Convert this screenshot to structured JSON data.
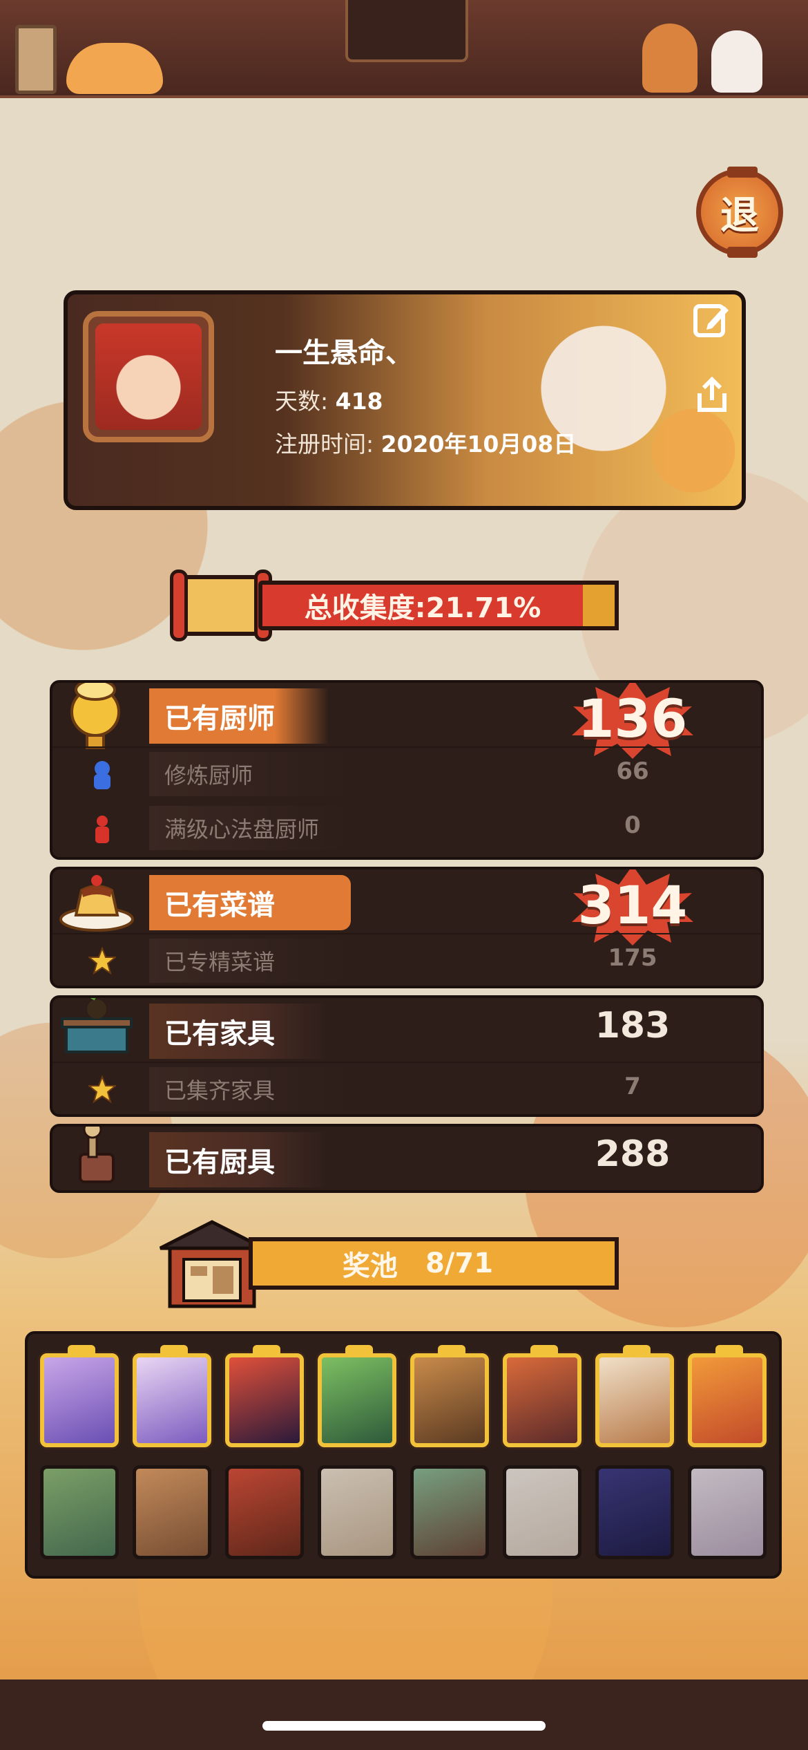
{
  "exit_button": {
    "label": "退"
  },
  "profile": {
    "name": "一生悬命、",
    "days_label": "天数:",
    "days_value": "418",
    "register_label": "注册时间:",
    "register_value": "2020年10月08日",
    "edit_icon": "edit-icon",
    "share_icon": "share-icon"
  },
  "collection": {
    "label": "总收集度:21.71%"
  },
  "chefs": {
    "label": "已有厨师",
    "value": "136",
    "subs": [
      {
        "label": "修炼厨师",
        "value": "66",
        "icon": "blue-figure-icon"
      },
      {
        "label": "满级心法盘厨师",
        "value": "0",
        "icon": "red-figure-icon"
      }
    ]
  },
  "recipes": {
    "label": "已有菜谱",
    "value": "314",
    "subs": [
      {
        "label": "已专精菜谱",
        "value": "175",
        "icon": "star-icon"
      }
    ]
  },
  "furniture": {
    "label": "已有家具",
    "value": "183",
    "subs": [
      {
        "label": "已集齐家具",
        "value": "7",
        "icon": "star-icon"
      }
    ]
  },
  "utensils": {
    "label": "已有厨具",
    "value": "288"
  },
  "prize_pool": {
    "label": "奖池",
    "count": "8/71"
  },
  "pool_cards": {
    "collected": [
      {
        "colors": [
          "#c9a6e8",
          "#6a4fb3"
        ]
      },
      {
        "colors": [
          "#e9d6f3",
          "#7c5bbf"
        ]
      },
      {
        "colors": [
          "#e0503a",
          "#2a1a3a"
        ]
      },
      {
        "colors": [
          "#7dbf62",
          "#2e5a3a"
        ]
      },
      {
        "colors": [
          "#c98a4a",
          "#5a3a22"
        ]
      },
      {
        "colors": [
          "#d96a3a",
          "#5a2a2a"
        ]
      },
      {
        "colors": [
          "#f0e0c8",
          "#b87a4a"
        ]
      },
      {
        "colors": [
          "#f29a3a",
          "#c24a2a"
        ]
      }
    ],
    "uncollected": [
      {
        "colors": [
          "#8fbf7a",
          "#4a7a5a"
        ]
      },
      {
        "colors": [
          "#e8a56a",
          "#8a5a3a"
        ]
      },
      {
        "colors": [
          "#e0503a",
          "#6a2a1a"
        ]
      },
      {
        "colors": [
          "#f2e8d8",
          "#c8b49a"
        ]
      },
      {
        "colors": [
          "#8abf9a",
          "#6a4a3a"
        ]
      },
      {
        "colors": [
          "#f4efe8",
          "#d8ccc0"
        ]
      },
      {
        "colors": [
          "#3a3a8a",
          "#1a1a4a"
        ]
      },
      {
        "colors": [
          "#e8e2ec",
          "#b8a8c0"
        ]
      }
    ]
  }
}
